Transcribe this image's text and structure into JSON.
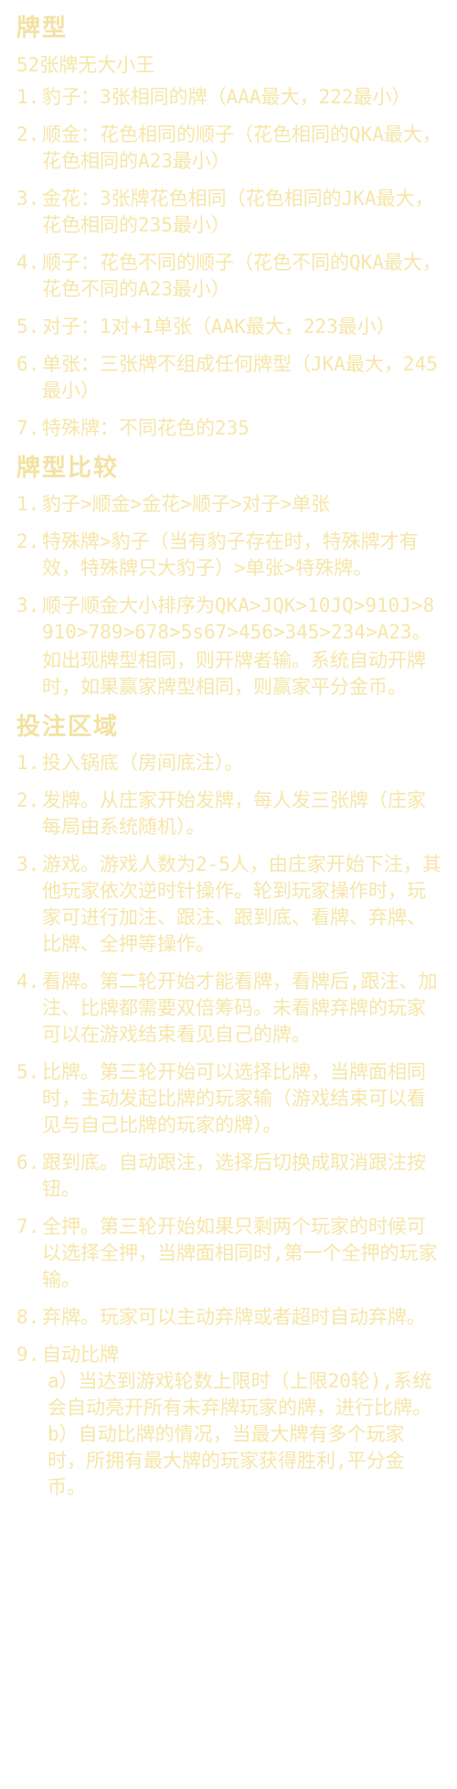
{
  "sec1": {
    "title": "牌型",
    "intro": "52张牌无大小王",
    "items": [
      {
        "n": "1.",
        "t": "豹子：3张相同的牌（AAA最大，222最小）"
      },
      {
        "n": "2.",
        "t": "顺金：花色相同的顺子（花色相同的QKA最大，花色相同的A23最小）"
      },
      {
        "n": "3.",
        "t": "金花：3张牌花色相同（花色相同的JKA最大，花色相同的235最小）"
      },
      {
        "n": "4.",
        "t": "顺子：花色不同的顺子（花色不同的QKA最大，花色不同的A23最小）"
      },
      {
        "n": "5.",
        "t": "对子：1对+1单张（AAK最大，223最小）"
      },
      {
        "n": "6.",
        "t": "单张：三张牌不组成任何牌型（JKA最大，245最小）"
      },
      {
        "n": "7.",
        "t": "特殊牌：不同花色的235"
      }
    ]
  },
  "sec2": {
    "title": "牌型比较",
    "items": [
      {
        "n": "1.",
        "t": "豹子>顺金>金花>顺子>对子>单张"
      },
      {
        "n": "2.",
        "t": "特殊牌>豹子（当有豹子存在时，特殊牌才有效，特殊牌只大豹子）>单张>特殊牌。"
      },
      {
        "n": "3.",
        "t": "顺子顺金大小排序为QKA>JQK>10JQ>910J>8910>789>678>5s67>456>345>234>A23。"
      }
    ],
    "note": "如出现牌型相同，则开牌者输。系统自动开牌时，如果赢家牌型相同，则赢家平分金币。"
  },
  "sec3": {
    "title": "投注区域",
    "items": [
      {
        "n": "1.",
        "t": "投入锅底（房间底注）。"
      },
      {
        "n": "2.",
        "t": "发牌。从庄家开始发牌，每人发三张牌（庄家每局由系统随机）。"
      },
      {
        "n": "3.",
        "t": "游戏。游戏人数为2-5人，由庄家开始下注，其他玩家依次逆时针操作。轮到玩家操作时，玩家可进行加注、跟注、跟到底、看牌、弃牌、比牌、全押等操作。"
      },
      {
        "n": "4.",
        "t": "看牌。第二轮开始才能看牌，看牌后,跟注、加注、比牌都需要双倍筹码。未看牌弃牌的玩家可以在游戏结束看见自己的牌。"
      },
      {
        "n": "5.",
        "t": "比牌。第三轮开始可以选择比牌，当牌面相同时，主动发起比牌的玩家输（游戏结束可以看见与自己比牌的玩家的牌）。"
      },
      {
        "n": "6.",
        "t": "跟到底。自动跟注，选择后切换成取消跟注按钮。"
      },
      {
        "n": "7.",
        "t": "全押。第三轮开始如果只剩两个玩家的时候可以选择全押，当牌面相同时,第一个全押的玩家输。"
      },
      {
        "n": "8.",
        "t": "弃牌。玩家可以主动弃牌或者超时自动弃牌。"
      },
      {
        "n": "9.",
        "t": "自动比牌"
      }
    ],
    "sub_a": "a）当达到游戏轮数上限时（上限20轮),系统会自动亮开所有未弃牌玩家的牌，进行比牌。",
    "sub_b": "b）自动比牌的情况，当最大牌有多个玩家时，所拥有最大牌的玩家获得胜利,平分金币。"
  }
}
